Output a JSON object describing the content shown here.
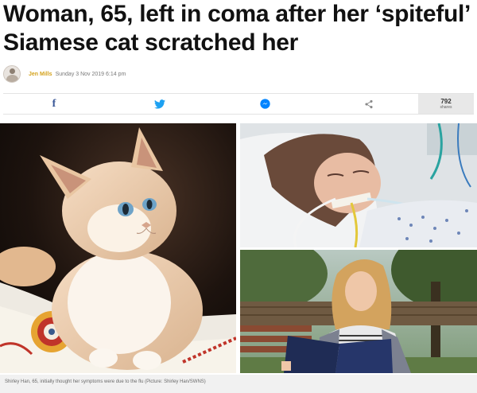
{
  "article": {
    "headline": "Woman, 65, left in coma after her ‘spiteful’ Siamese cat scratched her",
    "author": "Jen Mills",
    "date": "Sunday 3 Nov 2019 6:14 pm"
  },
  "share": {
    "facebook_icon": "facebook-icon",
    "twitter_icon": "twitter-icon",
    "messenger_icon": "messenger-icon",
    "share_icon": "share-icon",
    "count": "792",
    "count_label": "shares"
  },
  "images": {
    "left": "siamese-cat-photo",
    "top_right": "woman-in-hospital-bed-photo",
    "bottom_right": "woman-holding-folder-photo"
  },
  "caption": "Shirley Han, 65, initially thought her symptoms were due to the flu (Picture: Shirley Han/SWNS)",
  "colors": {
    "author": "#d4a21c",
    "facebook": "#3b5998",
    "twitter": "#1da1f2",
    "messenger": "#0084ff"
  }
}
